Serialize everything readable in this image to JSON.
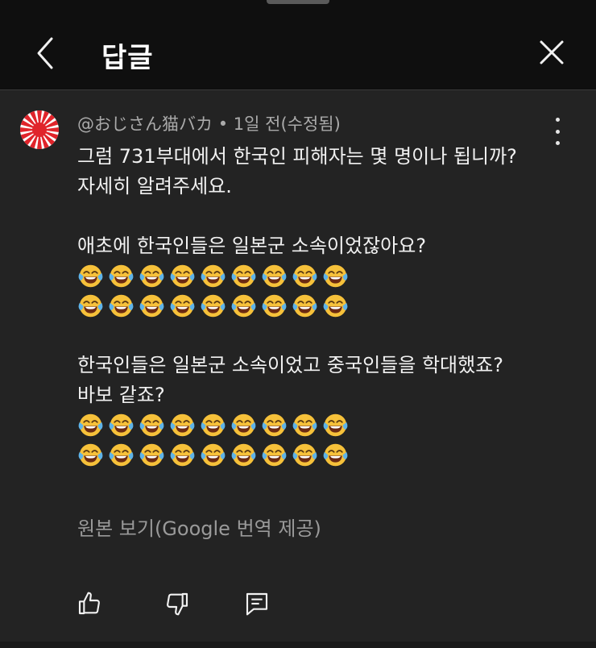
{
  "header": {
    "title": "답글",
    "back_icon": "chevron-left-icon",
    "close_icon": "close-icon"
  },
  "comment": {
    "author": "@おじさん猫バカ",
    "separator": "•",
    "time": "1일 전(수정됨)",
    "lines_1": [
      "그럼 731부대에서 한국인 피해자는 몇 명이나 됩니까?",
      "자세히 알려주세요."
    ],
    "lines_2": [
      "애초에 한국인들은 일본군 소속이었잖아요?"
    ],
    "lines_3": [
      "한국인들은 일본군 소속이었고 중국인들을 학대했죠?",
      "바보 같죠?"
    ],
    "emoji_name": "face-with-tears-of-joy-icon",
    "emoji_rows_per_block": 2,
    "emojis_per_row": 9,
    "translate_link": "원본 보기(Google 번역 제공)"
  },
  "actions": {
    "like_icon": "thumbs-up-icon",
    "dislike_icon": "thumbs-down-icon",
    "reply_icon": "reply-comment-icon"
  },
  "colors": {
    "background": "#232323",
    "header_bg": "#0f0f0f",
    "text": "#f1f1f1",
    "meta": "#aaaaaa",
    "avatar_red": "#e0242b"
  }
}
